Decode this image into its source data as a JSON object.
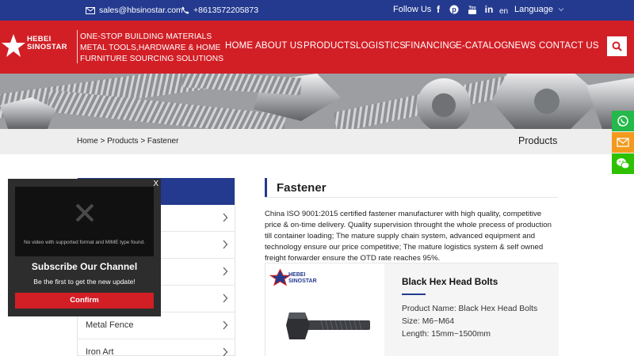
{
  "topbar": {
    "email": "sales@hbsinostar.com",
    "phone": "+8613572205873",
    "follow_label": "Follow Us",
    "social_icons": [
      "facebook-icon",
      "pinterest-icon",
      "youtube-icon",
      "linkedin-icon"
    ],
    "social_glyphs": [
      "f",
      "P",
      "You",
      "in"
    ],
    "lang_code": "en",
    "language_label": "Language"
  },
  "header": {
    "logo_line1": "HEBEI",
    "logo_line2": "SINOSTAR",
    "slogan": [
      "ONE-STOP BUILDING MATERIALS",
      "METAL TOOLS,HARDWARE & HOME",
      "FURNITURE SOURCING SOLUTIONS"
    ],
    "nav": [
      "HOME",
      "ABOUT US",
      "PRODUCTS",
      "LOGISTICS",
      "FINANCING",
      "E-CATALOG",
      "NEWS",
      "CONTACT US"
    ]
  },
  "breadcrumb": {
    "path": "Home > Products > Fastener",
    "section_title": "Products"
  },
  "sidebar": {
    "items": [
      "",
      "",
      "",
      "",
      "Metal Fence",
      "Iron Art"
    ]
  },
  "main": {
    "title": "Fastener",
    "intro": "China ISO 9001:2015 certified fastener manufacturer with high quality, competitive price & on-time delivery. Quality supervision throught the whole precess of production till container loading; The mature supply chain system, advanced equipment and technology ensure our price competitive; The mature logistics system & self owned freight forwarder ensure the OTD rate reaches 95%.",
    "product": {
      "name": "Black Hex Head Bolts",
      "logo_line1": "HEBEI",
      "logo_line2": "SINOSTAR",
      "specs": [
        "Product Name: Black Hex Head Bolts",
        "Size: M6~M64",
        "Length: 15mm~1500mm"
      ]
    }
  },
  "popup": {
    "close_label": "X",
    "video_message": "No video with supported format and MIME type found.",
    "title": "Subscribe Our Channel",
    "subtitle": "Be the first to get the new update!",
    "button_label": "Confirm"
  },
  "colors": {
    "brand_blue": "#243a8f",
    "brand_red": "#d21f26",
    "whatsapp_green": "#25b84a",
    "email_orange": "#f39a1e",
    "wechat_green": "#2dc100"
  }
}
